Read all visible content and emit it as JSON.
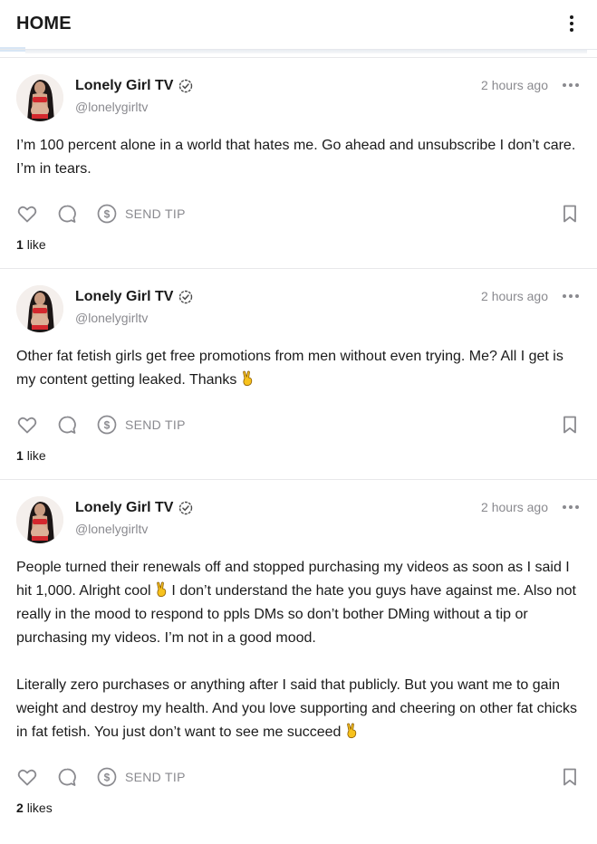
{
  "header": {
    "title": "HOME",
    "menu_icon": "more-vertical-icon"
  },
  "colors": {
    "text": "#1a1a1a",
    "muted": "#8a8a8f",
    "divider": "#e8e8ea"
  },
  "posts": [
    {
      "author": {
        "name": "Lonely Girl TV",
        "handle": "@lonelygirltv"
      },
      "time": "2 hours ago",
      "text": "I’m 100 percent alone in a world that hates me. Go ahead and unsubscribe I don’t care. I’m in tears.",
      "tip_label": "SEND TIP",
      "likes_count": "1",
      "likes_label": "like"
    },
    {
      "author": {
        "name": "Lonely Girl TV",
        "handle": "@lonelygirltv"
      },
      "time": "2 hours ago",
      "text_parts": [
        "Other fat fetish girls get free promotions from men without even trying. Me? All I get is my content getting leaked. Thanks "
      ],
      "tip_label": "SEND TIP",
      "likes_count": "1",
      "likes_label": "like"
    },
    {
      "author": {
        "name": "Lonely Girl TV",
        "handle": "@lonelygirltv"
      },
      "time": "2 hours ago",
      "text_parts": [
        "People turned their renewals off and stopped purchasing my videos as soon as I said I hit 1,000. Alright cool ",
        " I don’t understand the hate you guys have against me. Also not really in the mood to respond to ppls DMs so don’t bother DMing without a tip or purchasing my videos. I’m not in a good mood.\n\nLiterally zero purchases or anything after I said that publicly. But you want me to gain weight and destroy my health. And you love supporting and cheering on other fat chicks in fat fetish. You just don’t want to see me succeed "
      ],
      "tip_label": "SEND TIP",
      "likes_count": "2",
      "likes_label": "likes"
    }
  ]
}
